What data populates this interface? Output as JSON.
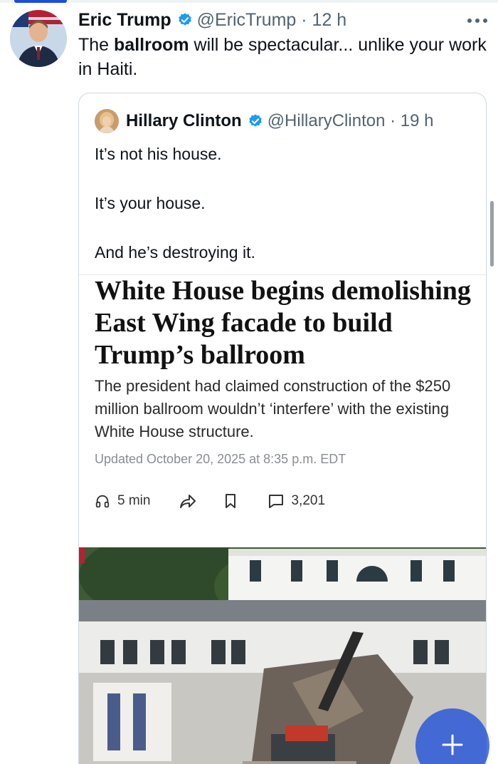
{
  "tweet": {
    "author_name": "Eric Trump",
    "handle": "@EricTrump",
    "time": "12 h",
    "text_before": "The ",
    "text_bold": "ballroom",
    "text_after": " will be spectacular... unlike your work in Haiti.",
    "more_icon": "more-horizontal-icon",
    "verified_icon": "verified-badge-icon"
  },
  "quote": {
    "author_name": "Hillary Clinton",
    "handle": "@HillaryClinton",
    "time": "19 h",
    "lines": [
      "It’s not his house.",
      "It’s your house.",
      "And he’s destroying it."
    ]
  },
  "article": {
    "headline": "White House begins demolishing East Wing facade to build Trump’s ballroom",
    "dek": "The president had claimed construction of the $250 million ballroom wouldn’t ‘interfere’ with the existing White House structure.",
    "updated": "Updated October 20, 2025 at 8:35 p.m. EDT",
    "listen_label": "5 min",
    "comments_count": "3,201"
  },
  "colors": {
    "verified": "#1d9bf0",
    "secondary_text": "#536471",
    "fab": "#1d4ed8"
  }
}
